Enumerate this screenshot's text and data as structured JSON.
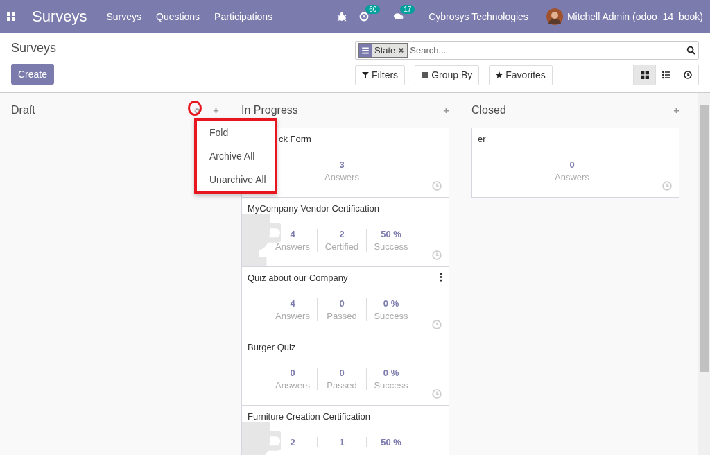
{
  "navbar": {
    "app_name": "Surveys",
    "menu": [
      "Surveys",
      "Questions",
      "Participations"
    ],
    "activity_count": "60",
    "message_count": "17",
    "company": "Cybrosys Technologies",
    "user": "Mitchell Admin (odoo_14_book)"
  },
  "breadcrumb": "Surveys",
  "create_button": "Create",
  "search": {
    "facet": "State",
    "placeholder": "Search..."
  },
  "search_buttons": [
    "Filters",
    "Group By",
    "Favorites"
  ],
  "views": [
    {
      "kind": "kanban",
      "selected": true
    },
    {
      "kind": "list",
      "selected": false
    },
    {
      "kind": "activity",
      "selected": false
    }
  ],
  "groups": [
    {
      "title": "Draft",
      "menu_open": true,
      "menu": [
        "Fold",
        "Archive All",
        "Unarchive All"
      ]
    },
    {
      "title": "In Progress",
      "menu_open": false,
      "cards": [
        {
          "title": "ck Form",
          "kind": "survey",
          "has_menu": false,
          "stats": [
            {
              "value": "3",
              "label": "Answers"
            }
          ]
        },
        {
          "title": "MyCompany Vendor Certification",
          "kind": "certification",
          "has_menu": false,
          "stats": [
            {
              "value": "4",
              "label": "Answers"
            },
            {
              "value": "2",
              "label": "Certified"
            },
            {
              "value": "50 %",
              "label": "Success"
            }
          ]
        },
        {
          "title": "Quiz about our Company",
          "kind": "survey",
          "has_menu": true,
          "stats": [
            {
              "value": "4",
              "label": "Answers"
            },
            {
              "value": "0",
              "label": "Passed"
            },
            {
              "value": "0 %",
              "label": "Success"
            }
          ]
        },
        {
          "title": "Burger Quiz",
          "kind": "survey",
          "has_menu": false,
          "stats": [
            {
              "value": "0",
              "label": "Answers"
            },
            {
              "value": "0",
              "label": "Passed"
            },
            {
              "value": "0 %",
              "label": "Success"
            }
          ]
        },
        {
          "title": "Furniture Creation Certification",
          "kind": "certification",
          "has_menu": false,
          "stats": [
            {
              "value": "2"
            },
            {
              "value": "1"
            },
            {
              "value": "50 %"
            }
          ]
        }
      ]
    },
    {
      "title": "Closed",
      "menu_open": false,
      "cards": [
        {
          "title": "er",
          "kind": "survey",
          "has_menu": false,
          "stats": [
            {
              "value": "0",
              "label": "Answers"
            }
          ]
        }
      ]
    }
  ]
}
